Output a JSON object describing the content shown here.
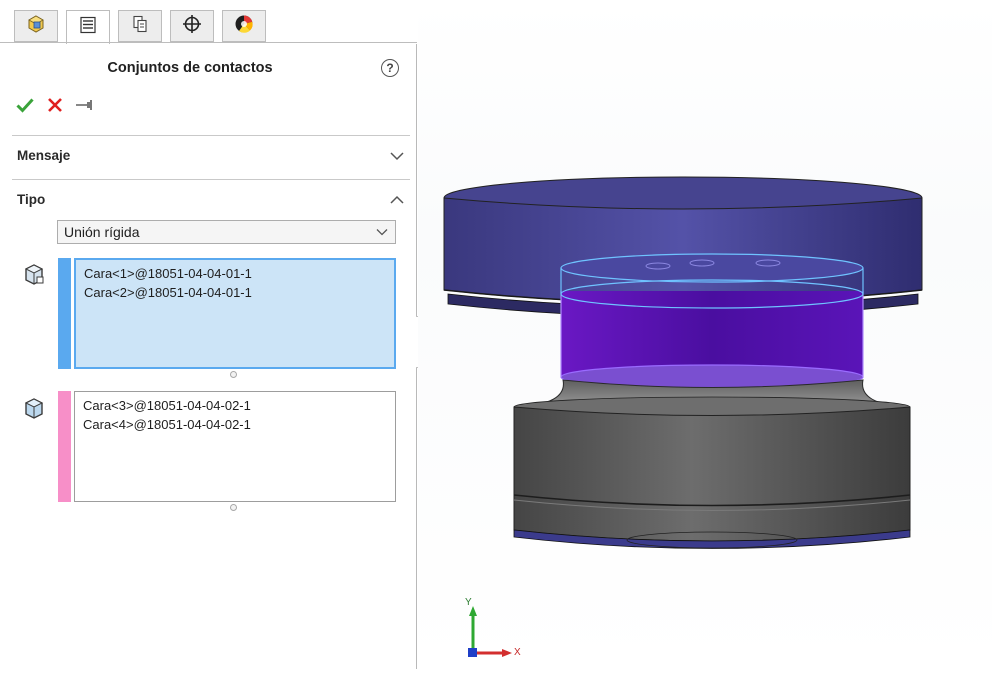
{
  "panel": {
    "tabs": [
      {
        "name": "featuremanager"
      },
      {
        "name": "propertymanager"
      },
      {
        "name": "configurationmanager"
      },
      {
        "name": "dimxpertmanager"
      },
      {
        "name": "displaymanager"
      }
    ],
    "title": "Conjuntos de contactos",
    "help_label": "?",
    "sections": {
      "message": {
        "label": "Mensaje",
        "expanded": false
      },
      "type": {
        "label": "Tipo",
        "expanded": true
      }
    },
    "type_select": {
      "value": "Unión rígida"
    },
    "set1": {
      "color": "#5aa9ef",
      "items": [
        "Cara<1>@18051-04-04-01-1",
        "Cara<2>@18051-04-04-01-1"
      ]
    },
    "set2": {
      "color": "#f78fc8",
      "items": [
        "Cara<3>@18051-04-04-02-1",
        "Cara<4>@18051-04-04-02-1"
      ]
    }
  },
  "viewport": {
    "triad": {
      "y_label": "Y",
      "x_label": "X"
    }
  },
  "colors": {
    "accept": "#3aa33a",
    "cancel": "#e02020",
    "selection_bg": "#cce4f7",
    "selection_border": "#5aa9ef",
    "part_top": "#3e3c88",
    "part_bottom": "#4a4a4a",
    "highlight": "#6a18c4"
  }
}
